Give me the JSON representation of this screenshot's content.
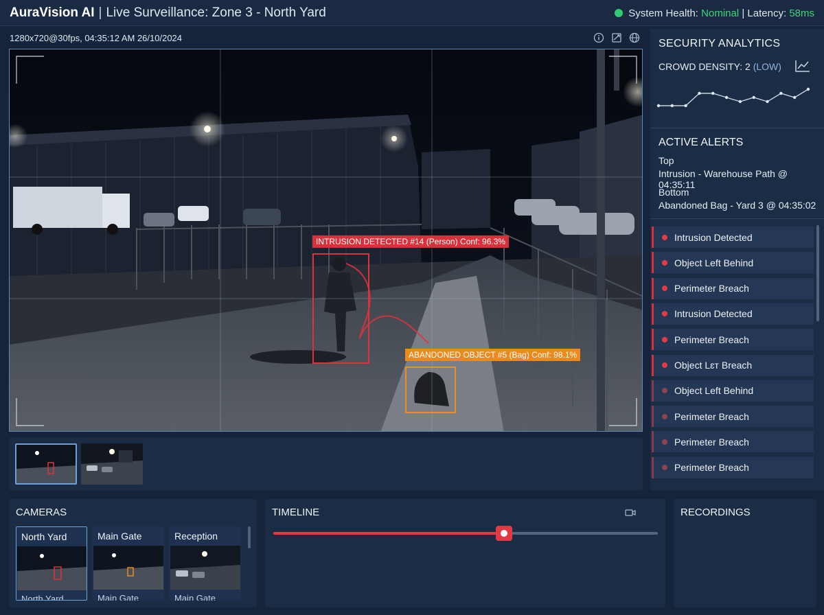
{
  "header": {
    "brand": "AuraVision AI",
    "separator": "|",
    "feed_title": "Live Surveillance: Zone 3 - North Yard",
    "health_label": "System Health:",
    "health_value": "Nominal",
    "latency_label": "| Latency:",
    "latency_value": "58ms",
    "health_color": "#2ecc71"
  },
  "video": {
    "meta": "1280x720@30fps, 04:35:12 AM 26/10/2024",
    "tool_icons": [
      "info-icon",
      "snapshot-icon",
      "settings-globe-icon"
    ],
    "detections": [
      {
        "label": "INTRUSION DETECTED #14 (Person) Conf: 96.3%",
        "color": "#d8313b"
      },
      {
        "label": "ABANDONED OBJECT #5 (Bag) Conf: 98.1%",
        "color": "#ee8a1c"
      }
    ]
  },
  "analytics": {
    "title": "SECURITY ANALYTICS",
    "crowd_label": "CROWD DENSITY: 2",
    "crowd_level": "(LOW)",
    "crowd_series": [
      3,
      3,
      3,
      6,
      6,
      5,
      4,
      5,
      4,
      6,
      5,
      7
    ]
  },
  "alerts": {
    "title": "ACTIVE ALERTS",
    "top_label": "Top",
    "top_text": "Intrusion - Warehouse Path @ 04:35:11",
    "bottom_label": "Bottom",
    "bottom_text": "Abandoned Bag - Yard 3 @ 04:35:02",
    "items": [
      "Intrusion Detected",
      "Object Left Behind",
      "Perimeter Breach",
      "Intrusion Detected",
      "Perimeter Breach",
      "Object Lɛт Breach",
      "Object Left Behind",
      "Perimeter Breach",
      "Perimeter Breach",
      "Perimeter Breach"
    ]
  },
  "cameras": {
    "title": "CAMERAS",
    "items": [
      {
        "name": "North Yard",
        "caption": "North Yard"
      },
      {
        "name": "Main Gate",
        "caption": "Main Gate"
      },
      {
        "name": "Reception",
        "caption": "Main Gate"
      }
    ]
  },
  "timeline": {
    "title": "TIMELINE",
    "position": 0.6
  },
  "recordings": {
    "title": "RECORDINGS"
  }
}
